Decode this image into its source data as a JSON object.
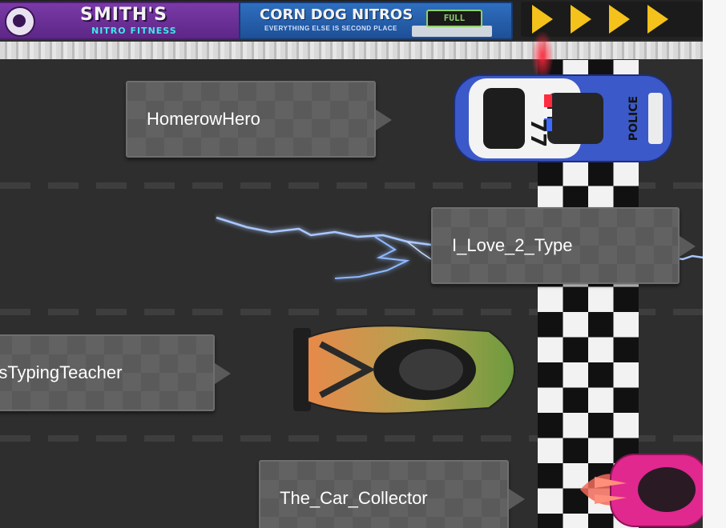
{
  "banner": {
    "ads": [
      {
        "name": "smiths",
        "line1": "SMITH'S",
        "line2": "NITRO FITNESS"
      },
      {
        "name": "corndog",
        "line1": "CORN DOG NITROS",
        "line2": "EVERYTHING ELSE IS SECOND PLACE",
        "gauge": "FULL"
      }
    ]
  },
  "racers": [
    {
      "name": "HomerowHero",
      "car": "police-car",
      "car_number": "77",
      "car_text": "POLICE"
    },
    {
      "name": "I_Love_2_Type",
      "car": "hidden",
      "effect": "lightning-nitro"
    },
    {
      "name": "MsTypingTeacher",
      "car": "orange-green-supercar"
    },
    {
      "name": "The_Car_Collector",
      "car": "pink-winged-car"
    }
  ],
  "colors": {
    "road": "#2e2e2e",
    "tag_background": "#5a5a5a",
    "police_blue": "#3b59c9",
    "lightning": "#8fb8ff",
    "finish_light": "#f2f2f2",
    "finish_dark": "#111111"
  }
}
